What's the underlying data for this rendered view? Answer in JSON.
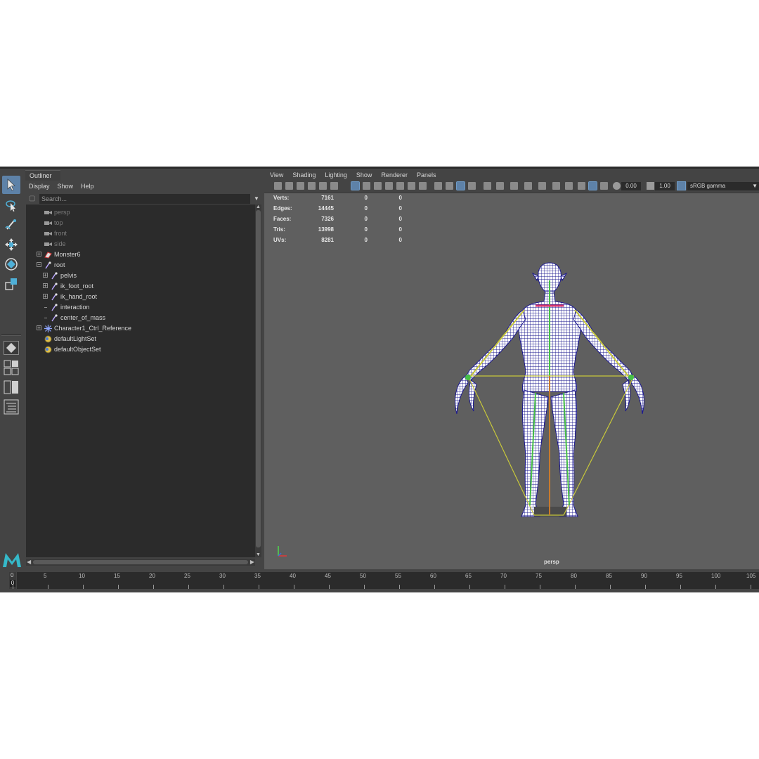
{
  "outliner": {
    "tab": "Outliner",
    "menu": [
      "Display",
      "Show",
      "Help"
    ],
    "search_placeholder": "Search...",
    "items": [
      {
        "label": "persp",
        "icon": "camera-icon",
        "dim": true
      },
      {
        "label": "top",
        "icon": "camera-icon",
        "dim": true
      },
      {
        "label": "front",
        "icon": "camera-icon",
        "dim": true
      },
      {
        "label": "side",
        "icon": "camera-icon",
        "dim": true
      },
      {
        "label": "Monster6",
        "icon": "mesh-icon",
        "dim": false
      },
      {
        "label": "root",
        "icon": "joint-icon",
        "dim": false
      },
      {
        "label": "pelvis",
        "icon": "joint-icon",
        "dim": false
      },
      {
        "label": "ik_foot_root",
        "icon": "joint-icon",
        "dim": false
      },
      {
        "label": "ik_hand_root",
        "icon": "joint-icon",
        "dim": false
      },
      {
        "label": "interaction",
        "icon": "joint-icon",
        "dim": false
      },
      {
        "label": "center_of_mass",
        "icon": "joint-icon",
        "dim": false
      },
      {
        "label": "Character1_Ctrl_Reference",
        "icon": "hik-reference-icon",
        "dim": false
      },
      {
        "label": "defaultLightSet",
        "icon": "set-icon",
        "dim": false
      },
      {
        "label": "defaultObjectSet",
        "icon": "set-icon",
        "dim": false
      }
    ]
  },
  "viewport": {
    "menu": [
      "View",
      "Shading",
      "Lighting",
      "Show",
      "Renderer",
      "Panels"
    ],
    "exposure": "0.00",
    "gamma": "1.00",
    "color_space": "sRGB gamma",
    "camera": "persp",
    "hud": [
      {
        "label": "Verts:",
        "v1": "7161",
        "v2": "0",
        "v3": "0"
      },
      {
        "label": "Edges:",
        "v1": "14445",
        "v2": "0",
        "v3": "0"
      },
      {
        "label": "Faces:",
        "v1": "7326",
        "v2": "0",
        "v3": "0"
      },
      {
        "label": "Tris:",
        "v1": "13998",
        "v2": "0",
        "v3": "0"
      },
      {
        "label": "UVs:",
        "v1": "8281",
        "v2": "0",
        "v3": "0"
      }
    ]
  },
  "timeline": {
    "current_top": "0",
    "current_bottom": "0",
    "ticks": [
      "0",
      "5",
      "10",
      "15",
      "20",
      "25",
      "30",
      "35",
      "40",
      "45",
      "50",
      "55",
      "60",
      "65",
      "70",
      "75",
      "80",
      "85",
      "90",
      "95",
      "100",
      "105"
    ]
  },
  "colors": {
    "selection": "#5e82a8",
    "wire": "#1d1a8f",
    "joint_yellow": "#c8c83a",
    "joint_green": "#46c046"
  }
}
